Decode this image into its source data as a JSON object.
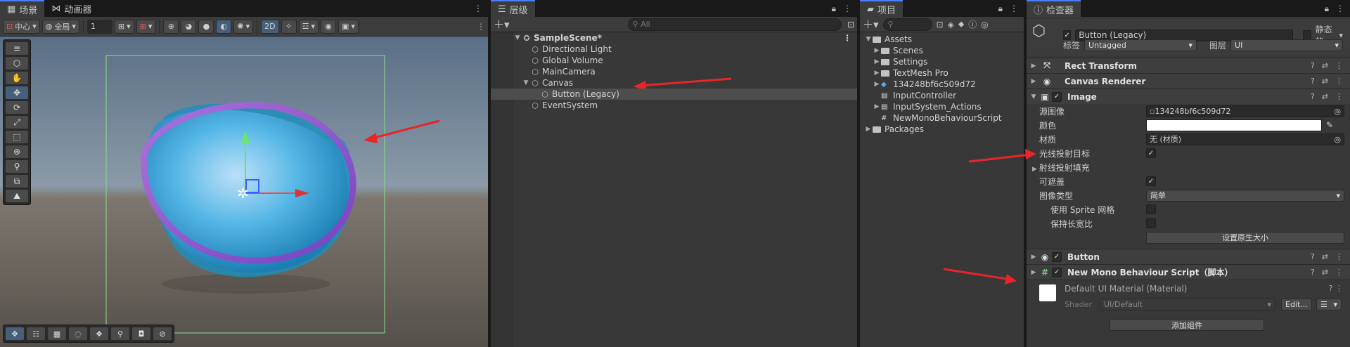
{
  "scene_panel": {
    "tabs": [
      {
        "label": "场景"
      },
      {
        "label": "动画器"
      }
    ],
    "pivot_label": "中心",
    "global_label": "全局",
    "grid_snap_value": "1",
    "mode_2d_label": "2D"
  },
  "hierarchy": {
    "tab_label": "层级",
    "search_placeholder": "All",
    "scene_name": "SampleScene*",
    "items": [
      {
        "label": "Directional Light"
      },
      {
        "label": "Global Volume"
      },
      {
        "label": "MainCamera"
      },
      {
        "label": "Canvas"
      },
      {
        "label": "Button (Legacy)"
      },
      {
        "label": "EventSystem"
      }
    ]
  },
  "project": {
    "tab_label": "项目",
    "root": "Assets",
    "items": [
      {
        "label": "Scenes"
      },
      {
        "label": "Settings"
      },
      {
        "label": "TextMesh Pro"
      },
      {
        "label": "134248bf6c509d72"
      },
      {
        "label": "InputController"
      },
      {
        "label": "InputSystem_Actions"
      },
      {
        "label": "NewMonoBehaviourScript"
      }
    ],
    "packages": "Packages"
  },
  "inspector": {
    "tab_label": "检查器",
    "object_name": "Button (Legacy)",
    "static_label": "静态的",
    "tag_label": "标签",
    "tag_value": "Untagged",
    "layer_label": "图层",
    "layer_value": "UI",
    "components": {
      "rect_transform": "Rect Transform",
      "canvas_renderer": "Canvas Renderer",
      "image": "Image",
      "button": "Button",
      "script": "New Mono Behaviour Script（脚本）"
    },
    "image_props": {
      "source_image_label": "源图像",
      "source_image_value": "134248bf6c509d72",
      "color_label": "颜色",
      "material_label": "材质",
      "material_value": "无 (材质)",
      "raycast_target_label": "光线投射目标",
      "raycast_padding_label": "射线投射填充",
      "maskable_label": "可遮盖",
      "image_type_label": "图像类型",
      "image_type_value": "简单",
      "use_sprite_mesh_label": "使用 Sprite 网格",
      "preserve_aspect_label": "保持长宽比",
      "native_size_button": "设置原生大小"
    },
    "material": {
      "name": "Default UI Material (Material)",
      "shader_label": "Shader",
      "shader_value": "UI/Default",
      "edit_button": "Edit..."
    },
    "add_component_button": "添加组件"
  },
  "colors": {
    "accent": "#4c7fff",
    "selection": "#46607c",
    "annotation_arrow": "#e8262a"
  }
}
